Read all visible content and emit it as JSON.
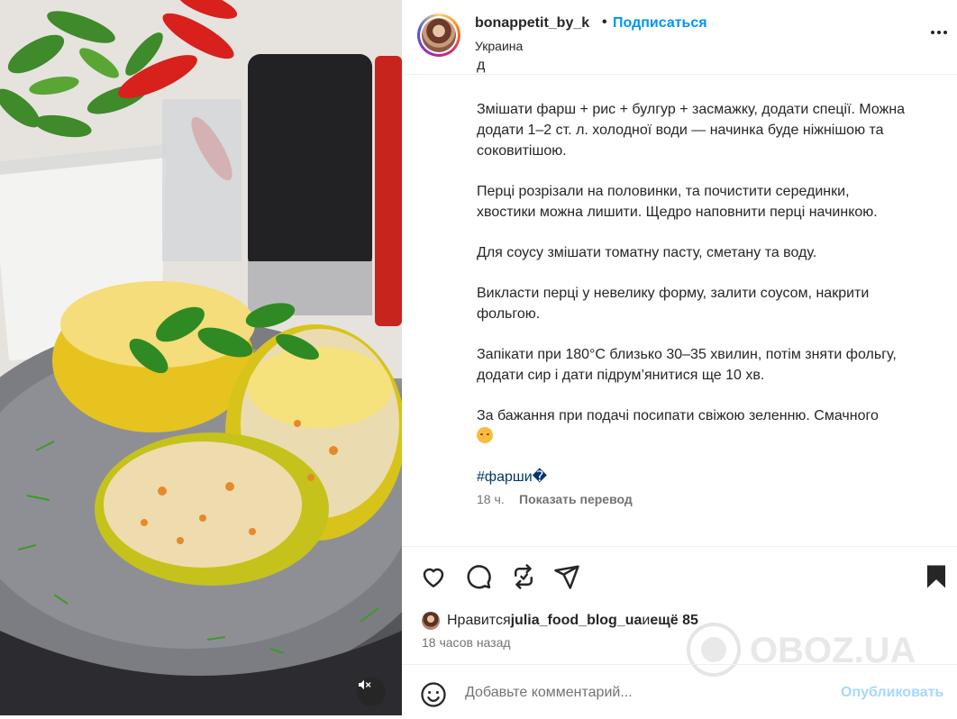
{
  "post": {
    "username": "bonappetit_by_k",
    "separator": "•",
    "follow_label": "Подписаться",
    "location": "Украина",
    "caption_cut_line": "д",
    "caption_paragraphs": [
      "Змішати фарш + рис + булгур + засмажку, додати спеції. Можна додати 1–2 ст. л. холодної води — начинка буде ніжнішою та соковитішою.",
      "Перці розрізали на половинки, та почистити серединки, хвостики можна лишити. Щедро наповнити перці начинкою.",
      "Для соусу змішати томатну пасту, сметану та воду.",
      "Викласти перці у невелику форму, залити соусом, накрити фольгою.",
      "Запікати при 180°C близько 30–35 хвилин, потім зняти фольгу, додати сир і дати підрум’янитися ще 10 хв.",
      "За бажання при подачі посипати свіжою зеленню. Смачного"
    ],
    "hashtag": "#фарши�",
    "time_short": "18 ч.",
    "translate_label": "Показать перевод"
  },
  "likes": {
    "prefix": "Нравится ",
    "user": "julia_food_blog_ua",
    "middle": " и ",
    "more": "ещё 85",
    "time_ago": "18 часов назад"
  },
  "comment": {
    "placeholder": "Добавьте комментарий...",
    "publish_label": "Опубликовать"
  },
  "watermark": {
    "text": "OBOZ.UA"
  },
  "icons": {
    "more": "more-options-icon",
    "like": "heart-icon",
    "comment": "comment-icon",
    "repost": "repost-icon",
    "share": "share-icon",
    "save": "bookmark-icon",
    "emoji": "emoji-icon",
    "mute": "audio-muted-icon"
  },
  "colors": {
    "link_blue": "#0095f6",
    "hashtag_blue": "#00376b",
    "muted_gray": "#737373",
    "publish_disabled": "#a6d8fb"
  }
}
